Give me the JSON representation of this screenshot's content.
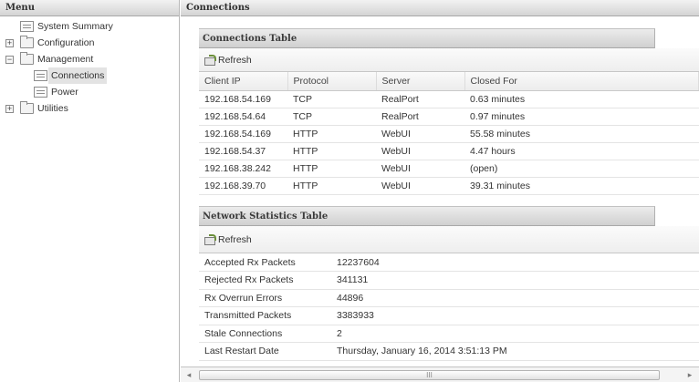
{
  "menu": {
    "title": "Menu",
    "items": [
      {
        "label": "System Summary"
      },
      {
        "label": "Configuration",
        "expander": "+"
      },
      {
        "label": "Management",
        "expander": "−"
      },
      {
        "label": "Connections"
      },
      {
        "label": "Power"
      },
      {
        "label": "Utilities",
        "expander": "+"
      }
    ]
  },
  "main": {
    "title": "Connections",
    "connections_table": {
      "title": "Connections Table",
      "refresh_label": "Refresh",
      "columns": [
        "Client IP",
        "Protocol",
        "Server",
        "Closed For"
      ],
      "rows": [
        [
          "192.168.54.169",
          "TCP",
          "RealPort",
          "0.63 minutes"
        ],
        [
          "192.168.54.64",
          "TCP",
          "RealPort",
          "0.97 minutes"
        ],
        [
          "192.168.54.169",
          "HTTP",
          "WebUI",
          "55.58 minutes"
        ],
        [
          "192.168.54.37",
          "HTTP",
          "WebUI",
          "4.47 hours"
        ],
        [
          "192.168.38.242",
          "HTTP",
          "WebUI",
          "(open)"
        ],
        [
          "192.168.39.70",
          "HTTP",
          "WebUI",
          "39.31 minutes"
        ]
      ]
    },
    "network_stats": {
      "title": "Network Statistics Table",
      "refresh_label": "Refresh",
      "rows": [
        [
          "Accepted Rx Packets",
          "12237604"
        ],
        [
          "Rejected Rx Packets",
          "341131"
        ],
        [
          "Rx Overrun Errors",
          "44896"
        ],
        [
          "Transmitted Packets",
          "3383933"
        ],
        [
          "Stale Connections",
          "2"
        ],
        [
          "Last Restart Date",
          "Thursday, January 16, 2014 3:51:13 PM"
        ]
      ]
    }
  },
  "scrollbar": {
    "left_arrow": "◂",
    "right_arrow": "▸",
    "thumb_grip": "III"
  }
}
